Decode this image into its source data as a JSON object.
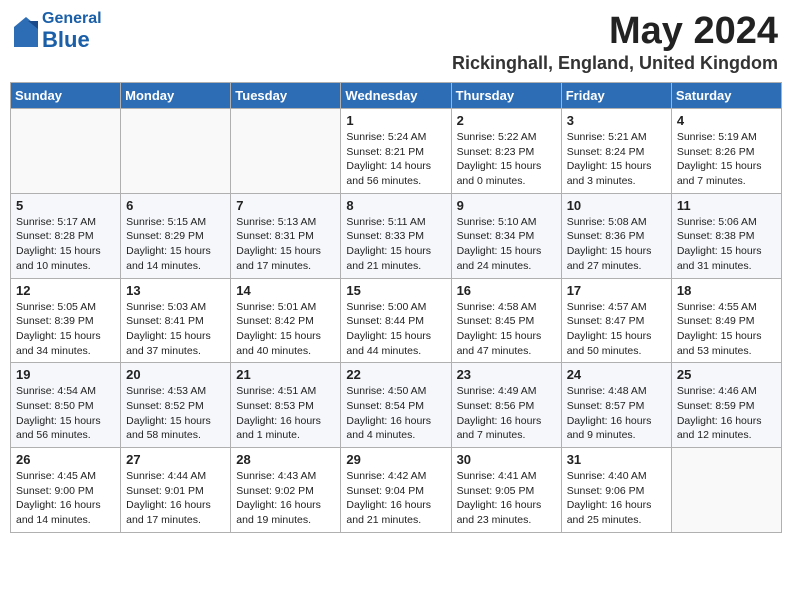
{
  "header": {
    "logo_general": "General",
    "logo_blue": "Blue",
    "title": "May 2024",
    "location": "Rickinghall, England, United Kingdom"
  },
  "weekdays": [
    "Sunday",
    "Monday",
    "Tuesday",
    "Wednesday",
    "Thursday",
    "Friday",
    "Saturday"
  ],
  "weeks": [
    [
      {
        "day": "",
        "sunrise": "",
        "sunset": "",
        "daylight": ""
      },
      {
        "day": "",
        "sunrise": "",
        "sunset": "",
        "daylight": ""
      },
      {
        "day": "",
        "sunrise": "",
        "sunset": "",
        "daylight": ""
      },
      {
        "day": "1",
        "sunrise": "Sunrise: 5:24 AM",
        "sunset": "Sunset: 8:21 PM",
        "daylight": "Daylight: 14 hours and 56 minutes."
      },
      {
        "day": "2",
        "sunrise": "Sunrise: 5:22 AM",
        "sunset": "Sunset: 8:23 PM",
        "daylight": "Daylight: 15 hours and 0 minutes."
      },
      {
        "day": "3",
        "sunrise": "Sunrise: 5:21 AM",
        "sunset": "Sunset: 8:24 PM",
        "daylight": "Daylight: 15 hours and 3 minutes."
      },
      {
        "day": "4",
        "sunrise": "Sunrise: 5:19 AM",
        "sunset": "Sunset: 8:26 PM",
        "daylight": "Daylight: 15 hours and 7 minutes."
      }
    ],
    [
      {
        "day": "5",
        "sunrise": "Sunrise: 5:17 AM",
        "sunset": "Sunset: 8:28 PM",
        "daylight": "Daylight: 15 hours and 10 minutes."
      },
      {
        "day": "6",
        "sunrise": "Sunrise: 5:15 AM",
        "sunset": "Sunset: 8:29 PM",
        "daylight": "Daylight: 15 hours and 14 minutes."
      },
      {
        "day": "7",
        "sunrise": "Sunrise: 5:13 AM",
        "sunset": "Sunset: 8:31 PM",
        "daylight": "Daylight: 15 hours and 17 minutes."
      },
      {
        "day": "8",
        "sunrise": "Sunrise: 5:11 AM",
        "sunset": "Sunset: 8:33 PM",
        "daylight": "Daylight: 15 hours and 21 minutes."
      },
      {
        "day": "9",
        "sunrise": "Sunrise: 5:10 AM",
        "sunset": "Sunset: 8:34 PM",
        "daylight": "Daylight: 15 hours and 24 minutes."
      },
      {
        "day": "10",
        "sunrise": "Sunrise: 5:08 AM",
        "sunset": "Sunset: 8:36 PM",
        "daylight": "Daylight: 15 hours and 27 minutes."
      },
      {
        "day": "11",
        "sunrise": "Sunrise: 5:06 AM",
        "sunset": "Sunset: 8:38 PM",
        "daylight": "Daylight: 15 hours and 31 minutes."
      }
    ],
    [
      {
        "day": "12",
        "sunrise": "Sunrise: 5:05 AM",
        "sunset": "Sunset: 8:39 PM",
        "daylight": "Daylight: 15 hours and 34 minutes."
      },
      {
        "day": "13",
        "sunrise": "Sunrise: 5:03 AM",
        "sunset": "Sunset: 8:41 PM",
        "daylight": "Daylight: 15 hours and 37 minutes."
      },
      {
        "day": "14",
        "sunrise": "Sunrise: 5:01 AM",
        "sunset": "Sunset: 8:42 PM",
        "daylight": "Daylight: 15 hours and 40 minutes."
      },
      {
        "day": "15",
        "sunrise": "Sunrise: 5:00 AM",
        "sunset": "Sunset: 8:44 PM",
        "daylight": "Daylight: 15 hours and 44 minutes."
      },
      {
        "day": "16",
        "sunrise": "Sunrise: 4:58 AM",
        "sunset": "Sunset: 8:45 PM",
        "daylight": "Daylight: 15 hours and 47 minutes."
      },
      {
        "day": "17",
        "sunrise": "Sunrise: 4:57 AM",
        "sunset": "Sunset: 8:47 PM",
        "daylight": "Daylight: 15 hours and 50 minutes."
      },
      {
        "day": "18",
        "sunrise": "Sunrise: 4:55 AM",
        "sunset": "Sunset: 8:49 PM",
        "daylight": "Daylight: 15 hours and 53 minutes."
      }
    ],
    [
      {
        "day": "19",
        "sunrise": "Sunrise: 4:54 AM",
        "sunset": "Sunset: 8:50 PM",
        "daylight": "Daylight: 15 hours and 56 minutes."
      },
      {
        "day": "20",
        "sunrise": "Sunrise: 4:53 AM",
        "sunset": "Sunset: 8:52 PM",
        "daylight": "Daylight: 15 hours and 58 minutes."
      },
      {
        "day": "21",
        "sunrise": "Sunrise: 4:51 AM",
        "sunset": "Sunset: 8:53 PM",
        "daylight": "Daylight: 16 hours and 1 minute."
      },
      {
        "day": "22",
        "sunrise": "Sunrise: 4:50 AM",
        "sunset": "Sunset: 8:54 PM",
        "daylight": "Daylight: 16 hours and 4 minutes."
      },
      {
        "day": "23",
        "sunrise": "Sunrise: 4:49 AM",
        "sunset": "Sunset: 8:56 PM",
        "daylight": "Daylight: 16 hours and 7 minutes."
      },
      {
        "day": "24",
        "sunrise": "Sunrise: 4:48 AM",
        "sunset": "Sunset: 8:57 PM",
        "daylight": "Daylight: 16 hours and 9 minutes."
      },
      {
        "day": "25",
        "sunrise": "Sunrise: 4:46 AM",
        "sunset": "Sunset: 8:59 PM",
        "daylight": "Daylight: 16 hours and 12 minutes."
      }
    ],
    [
      {
        "day": "26",
        "sunrise": "Sunrise: 4:45 AM",
        "sunset": "Sunset: 9:00 PM",
        "daylight": "Daylight: 16 hours and 14 minutes."
      },
      {
        "day": "27",
        "sunrise": "Sunrise: 4:44 AM",
        "sunset": "Sunset: 9:01 PM",
        "daylight": "Daylight: 16 hours and 17 minutes."
      },
      {
        "day": "28",
        "sunrise": "Sunrise: 4:43 AM",
        "sunset": "Sunset: 9:02 PM",
        "daylight": "Daylight: 16 hours and 19 minutes."
      },
      {
        "day": "29",
        "sunrise": "Sunrise: 4:42 AM",
        "sunset": "Sunset: 9:04 PM",
        "daylight": "Daylight: 16 hours and 21 minutes."
      },
      {
        "day": "30",
        "sunrise": "Sunrise: 4:41 AM",
        "sunset": "Sunset: 9:05 PM",
        "daylight": "Daylight: 16 hours and 23 minutes."
      },
      {
        "day": "31",
        "sunrise": "Sunrise: 4:40 AM",
        "sunset": "Sunset: 9:06 PM",
        "daylight": "Daylight: 16 hours and 25 minutes."
      },
      {
        "day": "",
        "sunrise": "",
        "sunset": "",
        "daylight": ""
      }
    ]
  ]
}
